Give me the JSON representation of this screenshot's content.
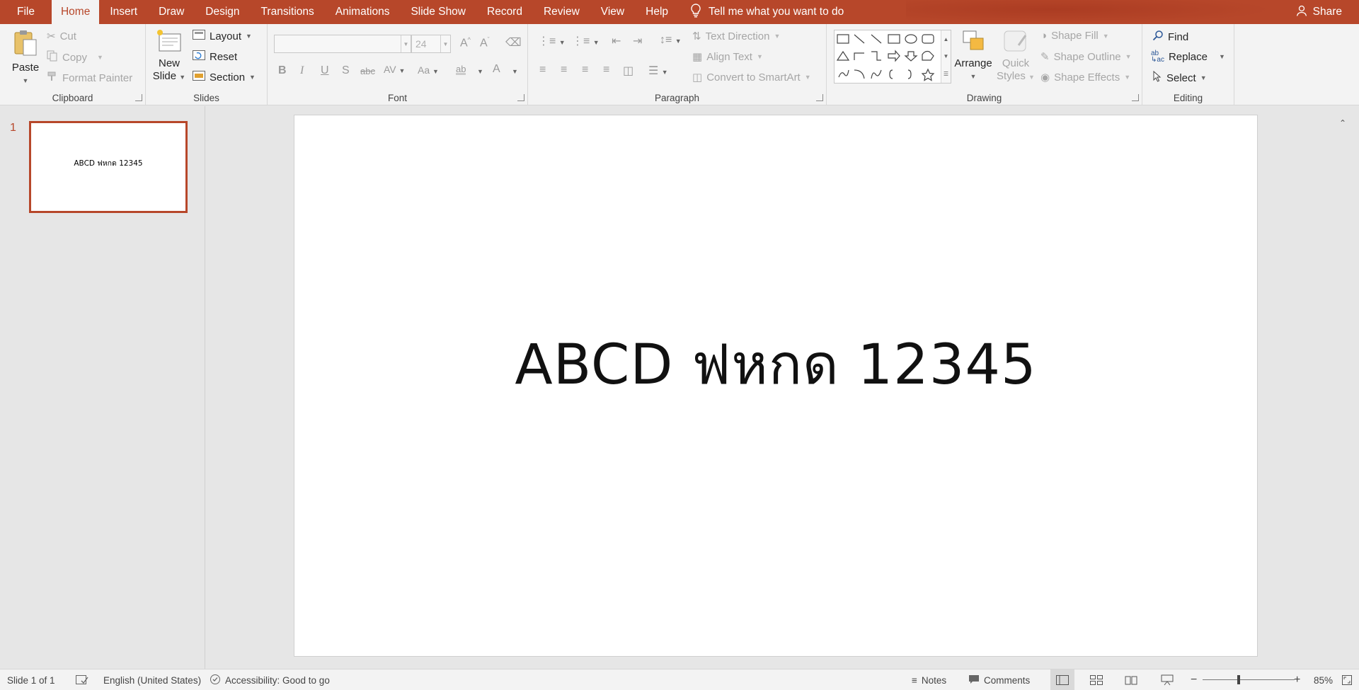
{
  "menu": {
    "items": [
      "File",
      "Home",
      "Insert",
      "Draw",
      "Design",
      "Transitions",
      "Animations",
      "Slide Show",
      "Record",
      "Review",
      "View",
      "Help"
    ],
    "active": "Home",
    "tell_me": "Tell me what you want to do",
    "share": "Share"
  },
  "ribbon": {
    "clipboard": {
      "label": "Clipboard",
      "paste": "Paste",
      "cut": "Cut",
      "copy": "Copy",
      "format_painter": "Format Painter"
    },
    "slides": {
      "label": "Slides",
      "new_slide_line1": "New",
      "new_slide_line2": "Slide",
      "layout": "Layout",
      "reset": "Reset",
      "section": "Section"
    },
    "font": {
      "label": "Font",
      "font_name": "",
      "font_size": "24"
    },
    "paragraph": {
      "label": "Paragraph",
      "text_direction": "Text Direction",
      "align_text": "Align Text",
      "convert_smartart": "Convert to SmartArt"
    },
    "drawing": {
      "label": "Drawing",
      "arrange": "Arrange",
      "quick_styles_line1": "Quick",
      "quick_styles_line2": "Styles",
      "shape_fill": "Shape Fill",
      "shape_outline": "Shape Outline",
      "shape_effects": "Shape Effects"
    },
    "editing": {
      "label": "Editing",
      "find": "Find",
      "replace": "Replace",
      "select": "Select"
    }
  },
  "thumbnails": [
    {
      "number": "1",
      "text": "ABCD ฟหกด 12345"
    }
  ],
  "slide": {
    "text": "ABCD ฟหกด 12345"
  },
  "status": {
    "slide_count": "Slide 1 of 1",
    "language": "English (United States)",
    "accessibility": "Accessibility: Good to go",
    "notes": "Notes",
    "comments": "Comments",
    "zoom": "85%"
  },
  "colors": {
    "accent": "#b7472a",
    "ribbon_bg": "#f3f3f3",
    "workspace": "#e6e6e6"
  }
}
